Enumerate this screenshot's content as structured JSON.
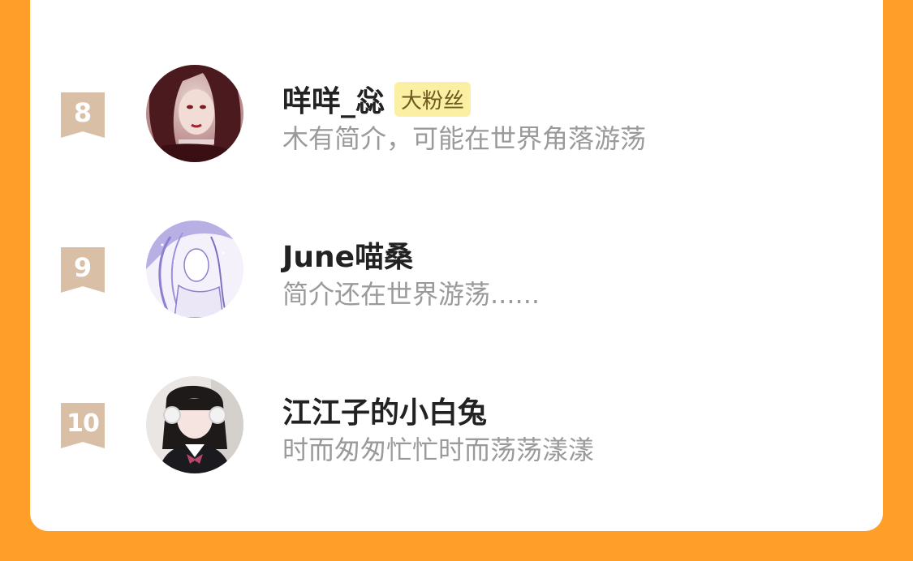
{
  "colors": {
    "background": "#FF9F2A",
    "card": "#ffffff",
    "rank_badge": "#D9BFA6",
    "fan_badge_bg": "#FBEFA4",
    "name": "#222222",
    "bio": "#9A9A9A"
  },
  "users": [
    {
      "rank": "8",
      "name": "咩咩_惢",
      "badge": "大粉丝",
      "bio": "木有简介，可能在世界角落游荡",
      "avatar_icon": "avatar-photo-girl-red-hair"
    },
    {
      "rank": "9",
      "name": "June喵桑",
      "badge": "",
      "bio": "简介还在世界游荡......",
      "avatar_icon": "avatar-illustration-purple"
    },
    {
      "rank": "10",
      "name": "江江子的小白兔",
      "badge": "",
      "bio": "时而匆匆忙忙时而荡荡漾漾",
      "avatar_icon": "avatar-photo-girl-headphones"
    }
  ]
}
